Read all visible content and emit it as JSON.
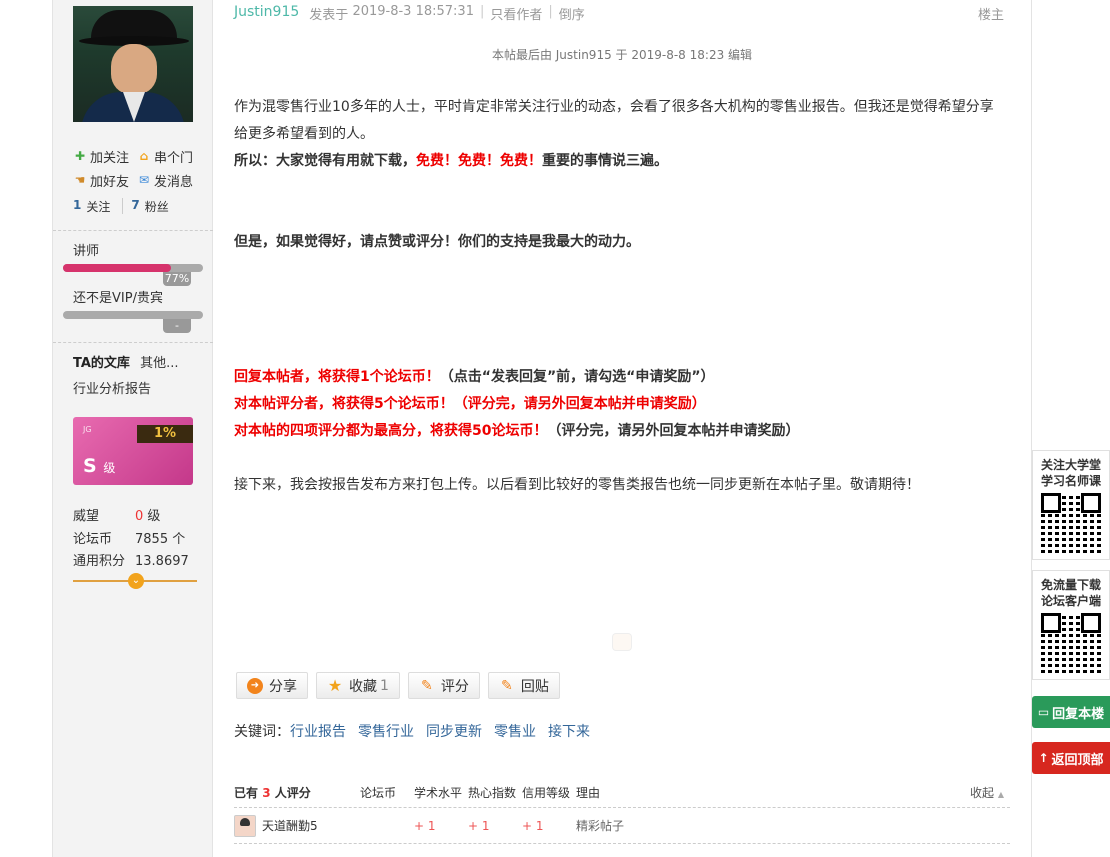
{
  "profile": {
    "actions": [
      {
        "label": "加关注",
        "icon": "plus-icon",
        "color": "#44aa44"
      },
      {
        "label": "串个门",
        "icon": "home-icon",
        "color": "#f2a31c"
      },
      {
        "label": "加好友",
        "icon": "handshake-icon",
        "color": "#d08a2a"
      },
      {
        "label": "发消息",
        "icon": "envelope-icon",
        "color": "#3a88d8"
      }
    ],
    "following_count": "1",
    "following_label": "关注",
    "fans_count": "7",
    "fans_label": "粉丝",
    "level1_label": "讲师",
    "level1_progress": 0.77,
    "level1_pct": "77%",
    "level2_label": "还不是VIP/贵宾",
    "level2_progress": 0,
    "level2_pct": "-",
    "library_title": "TA的文库",
    "library_more": "其他...",
    "library_item": "行业分析报告",
    "card_pct": "1%",
    "card_grade": "S",
    "card_grade_suffix": "级",
    "stats": [
      {
        "k": "威望",
        "v": "0",
        "unit": "级"
      },
      {
        "k": "论坛币",
        "v": "7855",
        "unit": "个"
      },
      {
        "k": "通用积分",
        "v": "13.8697",
        "unit": ""
      }
    ]
  },
  "post": {
    "author": "Justin915",
    "posted_label": "发表于",
    "posted_time": "2019-8-3 18:57:31",
    "only_author": "只看作者",
    "reverse": "倒序",
    "floor": "楼主",
    "edited_note": "本帖最后由 Justin915 于 2019-8-8 18:23 编辑",
    "p1": "作为混零售行业10多年的人士，平时肯定非常关注行业的动态，会看了很多各大机构的零售业报告。但我还是觉得希望分享给更多希望看到的人。",
    "p2_a": "所以：大家觉得有用就下载，",
    "p2_red": "免费！免费！免费！",
    "p2_b": "重要的事情说三遍。",
    "p3": "但是，如果觉得好，请点赞或评分！你们的支持是我最大的动力。",
    "r1_red": "回复本帖者，将获得1个论坛币！",
    "r1_b": "（点击“发表回复”前，请勾选“申请奖励”）",
    "r2_red": "对本帖评分者，将获得5个论坛币！（评分完，请另外回复本帖并申请奖励）",
    "r3_red": "对本帖的四项评分都为最高分，将获得50论坛币！",
    "r3_b": "（评分完，请另外回复本帖并申请奖励）",
    "p_last": "接下来，我会按报告发布方来打包上传。以后看到比较好的零售类报告也统一同步更新在本帖子里。敬请期待！"
  },
  "buttons": {
    "share": "分享",
    "favorite": "收藏",
    "favorite_count": "1",
    "rate": "评分",
    "reply": "回贴"
  },
  "keywords": {
    "label": "关键词：",
    "items": [
      "行业报告",
      "零售行业",
      "同步更新",
      "零售业",
      "接下来"
    ]
  },
  "rating": {
    "prefix": "已有",
    "count": "3",
    "suffix": "人评分",
    "cols": [
      "论坛币",
      "学术水平",
      "热心指数",
      "信用等级",
      "理由"
    ],
    "collapse": "收起",
    "rows": [
      {
        "user": "天道酬勤5",
        "coins": "",
        "academic": "+ 1",
        "enthusiasm": "+ 1",
        "credit": "+ 1",
        "reason": "精彩帖子"
      }
    ]
  },
  "floating": {
    "box1_title": "关注大学堂学习名师课",
    "box2_title": "免流量下载论坛客户端",
    "reply_floor": "回复本楼",
    "back_top": "返回顶部",
    "reply_color": "#2a9a5a",
    "top_color": "#d7271f"
  }
}
